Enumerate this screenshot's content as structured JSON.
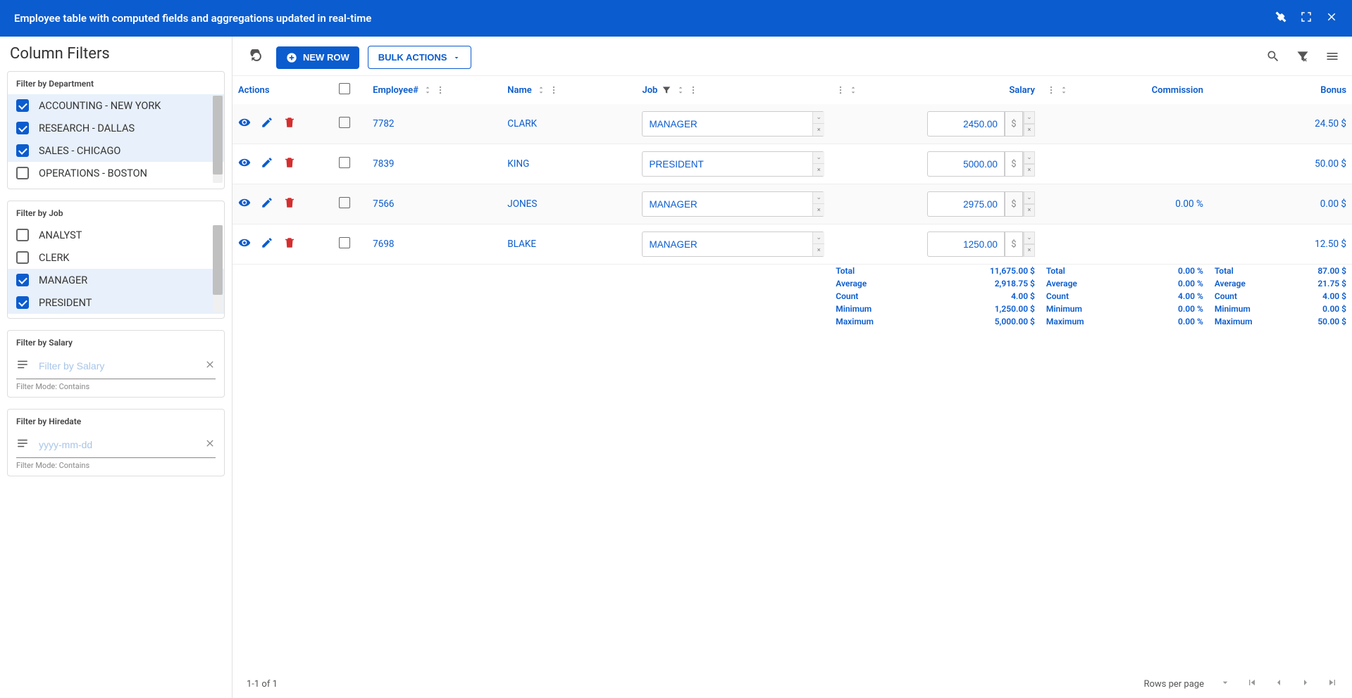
{
  "topbar": {
    "title": "Employee table with computed fields and aggregations updated in real-time"
  },
  "sidebar": {
    "heading": "Column Filters",
    "dept": {
      "title": "Filter by Department",
      "items": [
        {
          "label": "ACCOUNTING - NEW YORK",
          "checked": true
        },
        {
          "label": "RESEARCH - DALLAS",
          "checked": true
        },
        {
          "label": "SALES - CHICAGO",
          "checked": true
        },
        {
          "label": "OPERATIONS - BOSTON",
          "checked": false
        }
      ]
    },
    "job": {
      "title": "Filter by Job",
      "items": [
        {
          "label": "ANALYST",
          "checked": false
        },
        {
          "label": "CLERK",
          "checked": false
        },
        {
          "label": "MANAGER",
          "checked": true
        },
        {
          "label": "PRESIDENT",
          "checked": true
        }
      ]
    },
    "salary": {
      "title": "Filter by Salary",
      "placeholder": "Filter by Salary",
      "mode": "Filter Mode: Contains"
    },
    "hiredate": {
      "title": "Filter by Hiredate",
      "placeholder": "yyyy-mm-dd",
      "mode": "Filter Mode: Contains"
    }
  },
  "toolbar": {
    "new_row": "NEW ROW",
    "bulk_actions": "BULK ACTIONS"
  },
  "columns": {
    "actions": "Actions",
    "employee": "Employee#",
    "name": "Name",
    "job": "Job",
    "salary": "Salary",
    "commission": "Commission",
    "bonus": "Bonus"
  },
  "rows": [
    {
      "emp": "7782",
      "name": "CLARK",
      "job": "MANAGER",
      "salary": "2450.00",
      "commission": "",
      "bonus": "24.50 $"
    },
    {
      "emp": "7839",
      "name": "KING",
      "job": "PRESIDENT",
      "salary": "5000.00",
      "commission": "",
      "bonus": "50.00 $"
    },
    {
      "emp": "7566",
      "name": "JONES",
      "job": "MANAGER",
      "salary": "2975.00",
      "commission": "0.00 %",
      "bonus": "0.00 $"
    },
    {
      "emp": "7698",
      "name": "BLAKE",
      "job": "MANAGER",
      "salary": "1250.00",
      "commission": "",
      "bonus": "12.50 $"
    }
  ],
  "agg": {
    "labels": [
      "Total",
      "Average",
      "Count",
      "Minimum",
      "Maximum"
    ],
    "salary": [
      "11,675.00 $",
      "2,918.75 $",
      "4.00 $",
      "1,250.00 $",
      "5,000.00 $"
    ],
    "commission": [
      "0.00 %",
      "0.00 %",
      "4.00 %",
      "0.00 %",
      "0.00 %"
    ],
    "bonus": [
      "87.00 $",
      "21.75 $",
      "4.00 $",
      "0.00 $",
      "50.00 $"
    ]
  },
  "footer": {
    "range": "1-1 of 1",
    "rows_label": "Rows per page"
  }
}
